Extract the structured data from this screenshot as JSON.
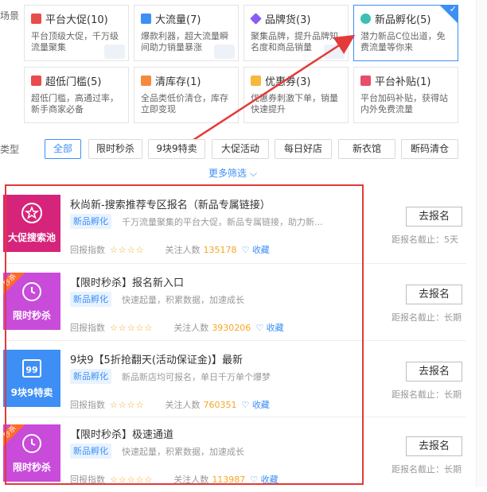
{
  "side_labels": {
    "scene": "场景",
    "type": "类型"
  },
  "scene_cards": [
    {
      "title": "平台大促(10)",
      "desc": "平台顶级大促，千万级流量聚集",
      "icon": "megaphone-icon",
      "color": "#e84c4c"
    },
    {
      "title": "大流量(7)",
      "desc": "爆款利器，超大流量瞬间助力销量暴涨",
      "icon": "grid-icon",
      "color": "#3d8ff5"
    },
    {
      "title": "品牌货(3)",
      "desc": "聚集品牌，提升品牌知名度和商品销量",
      "icon": "diamond-icon",
      "color": "#8a5cf5"
    },
    {
      "title": "新品孵化(5)",
      "desc": "潜力新品C位出道，免费流量等你来",
      "icon": "egg-icon",
      "color": "#3dbfb5",
      "selected": true
    },
    {
      "title": "超低门槛(5)",
      "desc": "超低门槛，高通过率，新手商家必备",
      "icon": "door-icon",
      "color": "#e84c4c"
    },
    {
      "title": "清库存(1)",
      "desc": "全品类低价清仓，库存立即变现",
      "icon": "box-icon",
      "color": "#f58a3d"
    },
    {
      "title": "优惠券(3)",
      "desc": "优惠券刺激下单，销量快速提升",
      "icon": "coupon-icon",
      "color": "#f5b93d"
    },
    {
      "title": "平台补贴(1)",
      "desc": "平台加码补贴，获得站内外免费流量",
      "icon": "gift-icon",
      "color": "#e84c6b"
    }
  ],
  "type_filters": [
    "全部",
    "限时秒杀",
    "9块9特卖",
    "大促活动",
    "每日好店",
    "新衣馆",
    "断码清仓"
  ],
  "more_filter": "更多筛选",
  "labels": {
    "return_index": "回报指数",
    "followers": "关注人数",
    "favorite": "收藏",
    "apply": "去报名"
  },
  "activities": [
    {
      "thumb_label": "大促搜索池",
      "thumb_color": "#d6247a",
      "thumb_icon": "star-circle-icon",
      "ribbon": "",
      "title": "秋尚新-搜索推荐专区报名（新品专属链接）",
      "tag": "新品孵化",
      "desc": "千万流量聚集的平台大促，新品专属链接，助力新...",
      "stars": "☆☆☆☆",
      "followers": "135178",
      "deadline": "距报名截止：5天"
    },
    {
      "thumb_label": "限时秒杀",
      "thumb_color": "#c84bd9",
      "thumb_icon": "clock-icon",
      "ribbon": "秒杀",
      "title": "【限时秒杀】报名新入口",
      "tag": "新品孵化",
      "desc": "快速起量，积累数据，加速成长",
      "stars": "☆☆☆☆☆",
      "followers": "3930206",
      "deadline": "距报名截止：长期"
    },
    {
      "thumb_label": "9块9特卖",
      "thumb_color": "#3d8ff5",
      "thumb_icon": "calendar-99-icon",
      "ribbon": "",
      "title": "9块9【5折抢翻天(活动保证金)】最新",
      "tag": "新品孵化",
      "desc": "新品新店均可报名，单日千万单个爆梦",
      "stars": "☆☆☆☆",
      "followers": "760351",
      "deadline": "距报名截止：长期"
    },
    {
      "thumb_label": "限时秒杀",
      "thumb_color": "#c84bd9",
      "thumb_icon": "clock-icon",
      "ribbon": "秒杀",
      "title": "【限时秒杀】极速通道",
      "tag": "新品孵化",
      "desc": "快速起量，积累数据，加速成长",
      "stars": "☆☆☆☆☆",
      "followers": "113987",
      "deadline": "距报名截止：长期"
    }
  ],
  "colors": {
    "accent": "#3d8ff5",
    "highlight_box": "#e33a3a",
    "arrow": "#e33a3a"
  }
}
